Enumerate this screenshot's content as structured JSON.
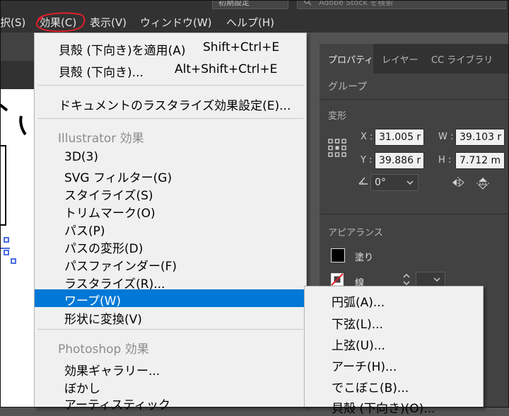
{
  "menubar": {
    "items": [
      "択(S)",
      "効果(C)",
      "表示(V)",
      "ウィンドウ(W)",
      "ヘルプ(H)"
    ],
    "preset": "初期設定",
    "stock_search_placeholder": "Adobe Stock を検索"
  },
  "effect_menu": {
    "apply_last": {
      "label": "貝殻 (下向き)を適用(A)",
      "shortcut": "Shift+Ctrl+E"
    },
    "last_effect": {
      "label": "貝殻 (下向き)...",
      "shortcut": "Alt+Shift+Ctrl+E"
    },
    "raster_settings": "ドキュメントのラスタライズ効果設定(E)...",
    "illustrator_header": "Illustrator 効果",
    "illustrator_items": [
      "3D(3)",
      "SVG フィルター(G)",
      "スタイライズ(S)",
      "トリムマーク(O)",
      "パス(P)",
      "パスの変形(D)",
      "パスファインダー(F)",
      "ラスタライズ(R)...",
      "ワープ(W)",
      "形状に変換(V)"
    ],
    "photoshop_header": "Photoshop 効果",
    "photoshop_items": [
      "効果ギャラリー...",
      "ぼかし",
      "アーティスティック"
    ]
  },
  "warp_submenu": {
    "items": [
      "円弧(A)...",
      "下弦(L)...",
      "上弦(U)...",
      "アーチ(H)...",
      "でこぼこ(B)...",
      "貝殻 (下向き)(O)..."
    ]
  },
  "properties_panel": {
    "tabs": [
      "プロパティ",
      "レイヤー",
      "CC ライブラリ"
    ],
    "object_type": "グループ",
    "transform_label": "変形",
    "x_label": "X :",
    "x_value": "31.005 r",
    "w_label": "W :",
    "w_value": "39.103 r",
    "y_label": "Y :",
    "y_value": "39.886 r",
    "h_label": "H :",
    "h_value": "7.712 m",
    "angle_value": "0°",
    "appearance_label": "アピアランス",
    "fill_label": "塗り",
    "stroke_label": "線"
  },
  "colors": {
    "highlight": "#0078d7",
    "annotation": "#e0202a",
    "selection": "#4a6ee0"
  }
}
